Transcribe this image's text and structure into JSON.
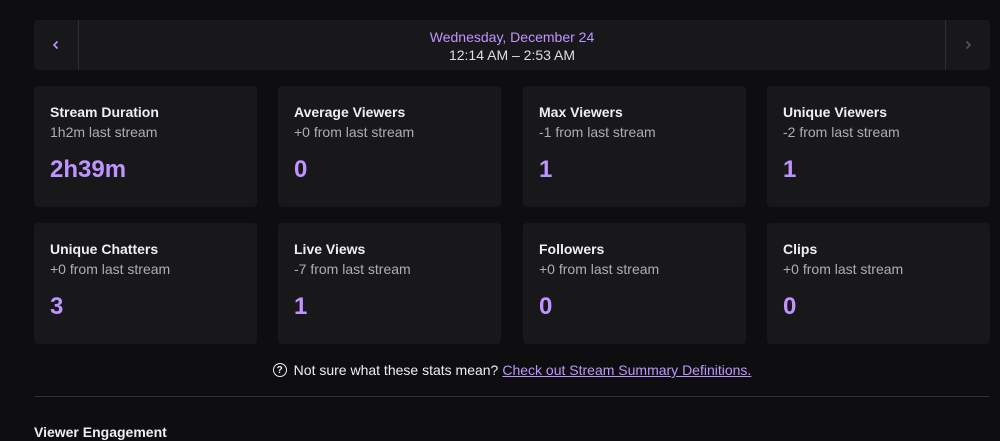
{
  "nav": {
    "date": "Wednesday, December 24",
    "time_range": "12:14 AM – 2:53 AM",
    "prev_icon": "chevron-left-icon",
    "next_icon": "chevron-right-icon"
  },
  "stats": [
    {
      "title": "Stream Duration",
      "sub": "1h2m last stream",
      "value": "2h39m"
    },
    {
      "title": "Average Viewers",
      "sub": "+0 from last stream",
      "value": "0"
    },
    {
      "title": "Max Viewers",
      "sub": "-1 from last stream",
      "value": "1"
    },
    {
      "title": "Unique Viewers",
      "sub": "-2 from last stream",
      "value": "1"
    },
    {
      "title": "Unique Chatters",
      "sub": "+0 from last stream",
      "value": "3"
    },
    {
      "title": "Live Views",
      "sub": "-7 from last stream",
      "value": "1"
    },
    {
      "title": "Followers",
      "sub": "+0 from last stream",
      "value": "0"
    },
    {
      "title": "Clips",
      "sub": "+0 from last stream",
      "value": "0"
    }
  ],
  "help": {
    "icon": "question-circle-icon",
    "text": "Not sure what these stats mean?",
    "link": "Check out Stream Summary Definitions."
  },
  "section": {
    "title": "Viewer Engagement"
  },
  "colors": {
    "accent": "#bf94ff",
    "background": "#0e0e10",
    "card": "#18181b"
  }
}
